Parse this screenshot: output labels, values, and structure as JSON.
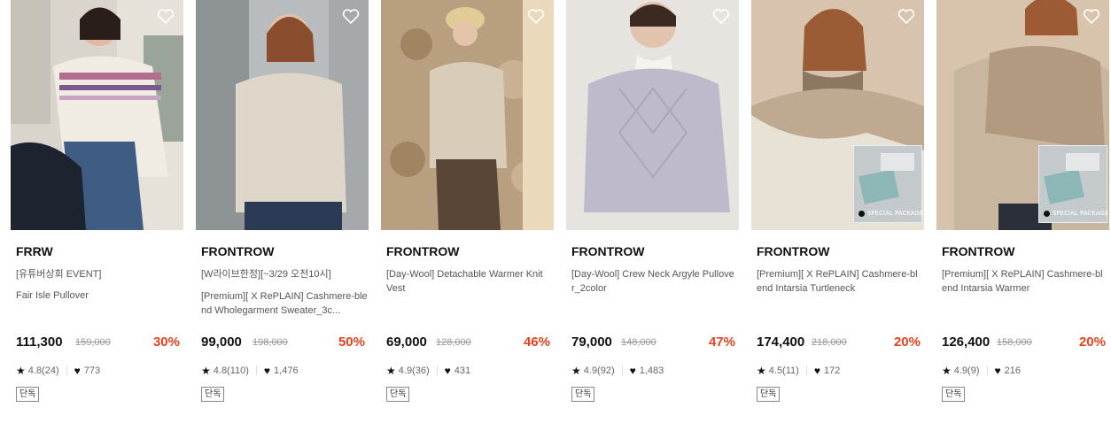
{
  "products": [
    {
      "brand": "FRRW",
      "name_line1": "[유튜버상회 EVENT]",
      "name_line2": "Fair Isle Pullover",
      "price": "111,300",
      "original_price": "159,000",
      "discount": "30%",
      "rating": "4.8(24)",
      "likes": "773",
      "tag": "단독"
    },
    {
      "brand": "FRONTROW",
      "name_line1": "[W라이브한정][~3/29 오전10시]",
      "name_line2": "[Premium][ X RePLAIN] Cashmere-blend Wholegarment Sweater_3c...",
      "price": "99,000",
      "original_price": "198,000",
      "discount": "50%",
      "rating": "4.8(110)",
      "likes": "1,476",
      "tag": "단독"
    },
    {
      "brand": "FRONTROW",
      "name": "[Day-Wool] Detachable Warmer Knit Vest",
      "price": "69,000",
      "original_price": "128,000",
      "discount": "46%",
      "rating": "4.9(36)",
      "likes": "431",
      "tag": "단독"
    },
    {
      "brand": "FRONTROW",
      "name": "[Day-Wool] Crew Neck Argyle Pullover_2color",
      "price": "79,000",
      "original_price": "148,000",
      "discount": "47%",
      "rating": "4.9(92)",
      "likes": "1,483",
      "tag": "단독"
    },
    {
      "brand": "FRONTROW",
      "name": "[Premium][ X RePLAIN] Cashmere-blend Intarsia Turtleneck",
      "price": "174,400",
      "original_price": "218,000",
      "discount": "20%",
      "rating": "4.5(11)",
      "likes": "172",
      "tag": "단독",
      "package_label": "SPECIAL PACKAGE"
    },
    {
      "brand": "FRONTROW",
      "name": "[Premium][ X RePLAIN] Cashmere-blend Intarsia Warmer",
      "price": "126,400",
      "original_price": "158,000",
      "discount": "20%",
      "rating": "4.9(9)",
      "likes": "216",
      "tag": "단독",
      "package_label": "SPECIAL PACKAGE"
    }
  ],
  "icons": {
    "wishlist": "heart-outline-icon",
    "rating": "star-icon",
    "likes": "heart-filled-icon"
  },
  "colors": {
    "discount": "#e8411e",
    "text": "#111111",
    "muted": "#999999"
  }
}
